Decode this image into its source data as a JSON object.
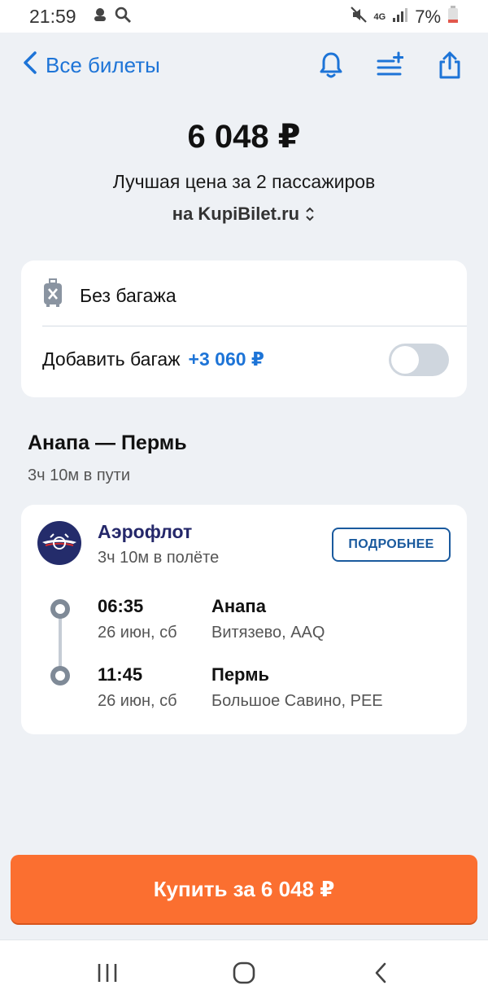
{
  "status_bar": {
    "time": "21:59",
    "network": "4G",
    "battery": "7%"
  },
  "nav": {
    "back_label": "Все билеты",
    "icons": [
      "bell-icon",
      "filter-add-icon",
      "share-icon"
    ]
  },
  "offer": {
    "price": "6 048 ₽",
    "description": "Лучшая цена за 2 пассажиров",
    "agent": "на KupiBilet.ru"
  },
  "baggage": {
    "current": "Без багажа",
    "add_label": "Добавить багаж",
    "add_price": "+3 060 ₽",
    "toggle_on": false
  },
  "route": {
    "title": "Анапа — Пермь",
    "total_duration": "3ч 10м в пути"
  },
  "flight": {
    "airline": "Аэрофлот",
    "flight_duration": "3ч 10м в полёте",
    "details_button": "ПОДРОБНЕЕ",
    "departure": {
      "time": "06:35",
      "date": "26 июн, сб",
      "city": "Анапа",
      "airport": "Витязево, AAQ"
    },
    "arrival": {
      "time": "11:45",
      "date": "26 июн, сб",
      "city": "Пермь",
      "airport": "Большое Савино, PEE"
    }
  },
  "buy_button": "Купить за 6 048 ₽",
  "colors": {
    "accent": "#1d74d7",
    "buy": "#fb6f30",
    "background": "#eef1f5"
  }
}
